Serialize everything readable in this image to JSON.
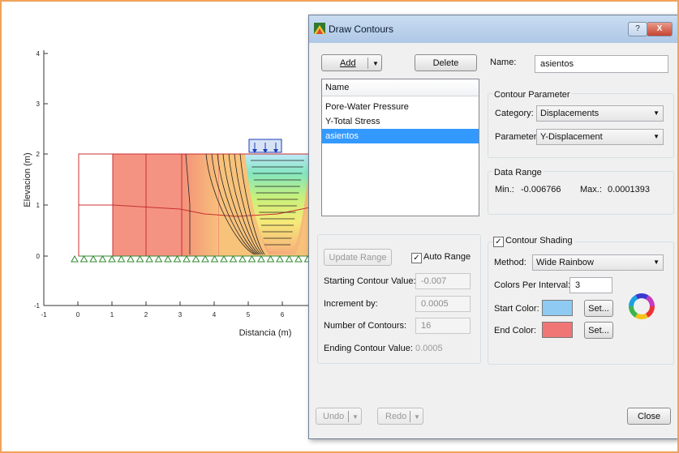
{
  "plot": {
    "y_axis_label": "Elevacion (m)",
    "x_axis_label": "Distancia (m)",
    "y_ticks": [
      "4",
      "3",
      "2",
      "1",
      "0",
      "-1"
    ],
    "x_ticks": [
      "-1",
      "0",
      "1",
      "2",
      "3",
      "4",
      "5",
      "6"
    ]
  },
  "dialog": {
    "title": "Draw Contours",
    "help_label": "?",
    "close_x_label": "X",
    "add_label": "Add",
    "delete_label": "Delete",
    "name_label": "Name:",
    "name_value": "asientos",
    "list_header": "Name",
    "list_items": [
      "Pore-Water Pressure",
      "Y-Total Stress",
      "asientos"
    ],
    "selected_item": "asientos",
    "contour_parameter": {
      "title": "Contour Parameter",
      "category_label": "Category:",
      "category_value": "Displacements",
      "parameter_label": "Parameter:",
      "parameter_value": "Y-Displacement"
    },
    "data_range": {
      "title": "Data Range",
      "min_label": "Min.:",
      "min_value": "-0.006766",
      "max_label": "Max.:",
      "max_value": "0.0001393"
    },
    "range": {
      "update_label": "Update Range",
      "auto_label": "Auto Range",
      "auto_checked": true,
      "start_label": "Starting Contour Value:",
      "start_value": "-0.007",
      "increment_label": "Increment by:",
      "increment_value": "0.0005",
      "count_label": "Number of Contours:",
      "count_value": "16",
      "ending_label": "Ending Contour Value:",
      "ending_value": "0.0005"
    },
    "shading": {
      "title": "Contour Shading",
      "checked": true,
      "method_label": "Method:",
      "method_value": "Wide Rainbow",
      "colors_label": "Colors Per Interval:",
      "colors_value": "3",
      "start_label": "Start Color:",
      "start_color": "#8fcaf2",
      "end_label": "End Color:",
      "end_color": "#f07575",
      "set_label": "Set..."
    },
    "undo_label": "Undo",
    "redo_label": "Redo",
    "close_label": "Close"
  }
}
